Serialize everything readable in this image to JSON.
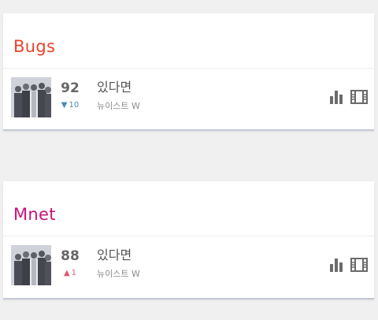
{
  "charts": [
    {
      "service": "Bugs",
      "color": "#e8432d",
      "entry": {
        "rank": "92",
        "change_direction": "down",
        "change_arrow": "▼",
        "change_value": "10",
        "title": "있다면",
        "artist": "뉴이스트 W"
      },
      "icons": [
        "bar-chart-icon",
        "film-strip-icon"
      ]
    },
    {
      "service": "Mnet",
      "color": "#c8127a",
      "entry": {
        "rank": "88",
        "change_direction": "up",
        "change_arrow": "▲",
        "change_value": "1",
        "title": "있다면",
        "artist": "뉴이스트 W"
      },
      "icons": [
        "bar-chart-icon",
        "film-strip-icon"
      ]
    }
  ]
}
